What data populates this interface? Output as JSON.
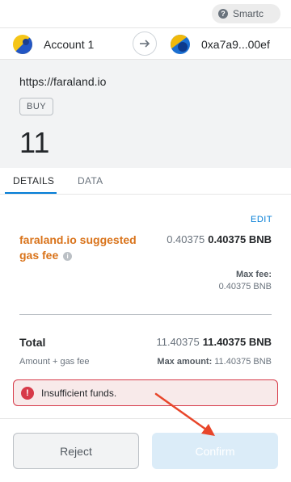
{
  "network": {
    "label": "Smartc",
    "icon": "help-icon"
  },
  "accounts": {
    "from": {
      "name": "Account 1"
    },
    "to": {
      "address": "0xa7a9...00ef"
    }
  },
  "transaction": {
    "origin": "https://faraland.io",
    "method": "BUY",
    "amount": "11"
  },
  "tabs": [
    {
      "label": "DETAILS",
      "active": true
    },
    {
      "label": "DATA",
      "active": false
    }
  ],
  "details": {
    "edit_label": "EDIT",
    "gas_label": "faraland.io suggested gas fee",
    "gas_value_light": "0.40375",
    "gas_value_bold": "0.40375 BNB",
    "max_fee_label": "Max fee:",
    "max_fee_value": "0.40375 BNB",
    "total_label": "Total",
    "total_value_light": "11.40375",
    "total_value_bold": "11.40375 BNB",
    "total_sub": "Amount + gas fee",
    "max_amount_label": "Max amount:",
    "max_amount_value": "11.40375 BNB"
  },
  "error": {
    "message": "Insufficient funds."
  },
  "buttons": {
    "reject": "Reject",
    "confirm": "Confirm"
  },
  "colors": {
    "accent": "#037dd6",
    "gas_label": "#d9731a",
    "error": "#d73a49",
    "annotation_arrow": "#e8462a"
  }
}
